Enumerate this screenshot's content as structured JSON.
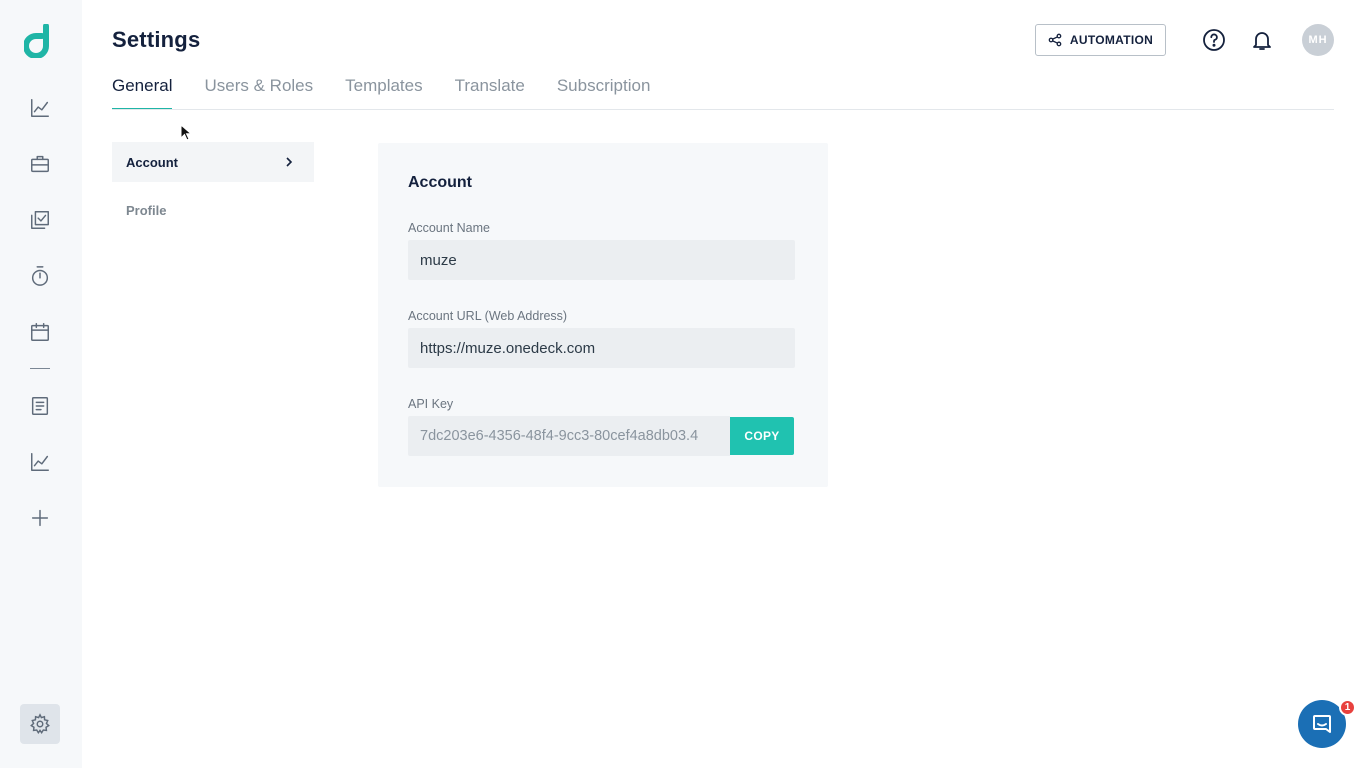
{
  "header": {
    "title": "Settings",
    "automation_label": "AUTOMATION",
    "avatar_initials": "MH"
  },
  "tabs": [
    {
      "label": "General",
      "active": true
    },
    {
      "label": "Users & Roles",
      "active": false
    },
    {
      "label": "Templates",
      "active": false
    },
    {
      "label": "Translate",
      "active": false
    },
    {
      "label": "Subscription",
      "active": false
    }
  ],
  "subnav": {
    "items": [
      {
        "label": "Account",
        "active": true
      },
      {
        "label": "Profile",
        "active": false
      }
    ]
  },
  "account": {
    "title": "Account",
    "name_label": "Account Name",
    "name_value": "muze",
    "url_label": "Account URL (Web Address)",
    "url_value": "https://muze.onedeck.com",
    "api_label": "API Key",
    "api_value": "7dc203e6-4356-48f4-9cc3-80cef4a8db03.4",
    "copy_label": "COPY"
  },
  "sidebar": {
    "icons": [
      "chart-line-icon",
      "briefcase-icon",
      "checklist-icon",
      "stopwatch-icon",
      "calendar-icon",
      "document-icon",
      "analytics-icon",
      "plus-icon",
      "settings-gear-icon"
    ]
  },
  "chat": {
    "badge_count": "1"
  },
  "colors": {
    "accent": "#1fb5a6",
    "copy_button": "#20c2b0",
    "chat_button": "#1b6fb5",
    "badge": "#e8413e",
    "title": "#14213d"
  }
}
